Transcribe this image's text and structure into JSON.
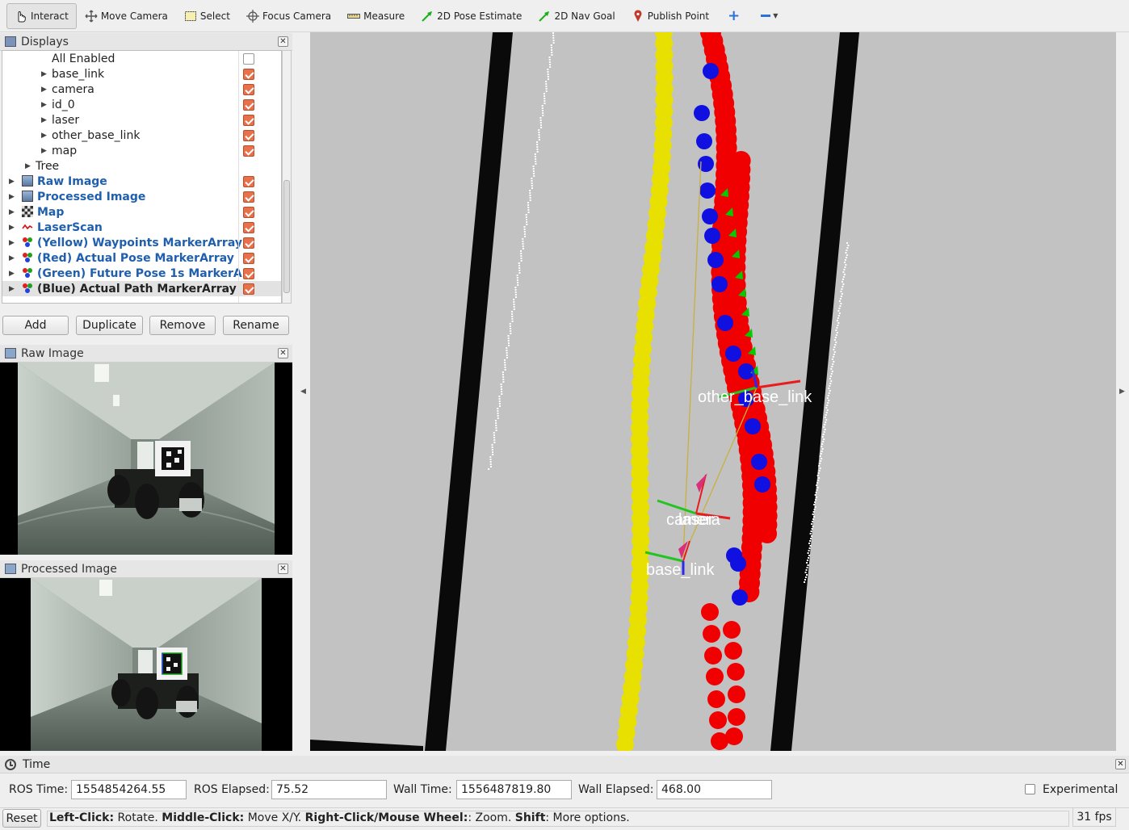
{
  "toolbar": {
    "tools": [
      {
        "label": "Interact",
        "icon": "hand-pointer-icon"
      },
      {
        "label": "Move Camera",
        "icon": "move-camera-icon"
      },
      {
        "label": "Select",
        "icon": "select-box-icon"
      },
      {
        "label": "Focus Camera",
        "icon": "crosshair-icon"
      },
      {
        "label": "Measure",
        "icon": "ruler-icon"
      },
      {
        "label": "2D Pose Estimate",
        "icon": "green-arrow-icon"
      },
      {
        "label": "2D Nav Goal",
        "icon": "green-arrow-icon"
      },
      {
        "label": "Publish Point",
        "icon": "map-pin-icon"
      }
    ]
  },
  "displays": {
    "title": "Displays",
    "items": [
      {
        "label": "All Enabled",
        "checked": false
      },
      {
        "label": "base_link",
        "checked": true
      },
      {
        "label": "camera",
        "checked": true
      },
      {
        "label": "id_0",
        "checked": true
      },
      {
        "label": "laser",
        "checked": true
      },
      {
        "label": "other_base_link",
        "checked": true
      },
      {
        "label": "map",
        "checked": true
      },
      {
        "label": "Tree"
      },
      {
        "label": "Raw Image",
        "checked": true
      },
      {
        "label": "Processed Image",
        "checked": true
      },
      {
        "label": "Map",
        "checked": true
      },
      {
        "label": "LaserScan",
        "checked": true
      },
      {
        "label": "(Yellow) Waypoints MarkerArray",
        "checked": true
      },
      {
        "label": "(Red) Actual Pose MarkerArray",
        "checked": true
      },
      {
        "label": "(Green) Future Pose 1s MarkerA...",
        "checked": true
      },
      {
        "label": "(Blue) Actual Path MarkerArray",
        "checked": true
      }
    ],
    "buttons": {
      "add": "Add",
      "duplicate": "Duplicate",
      "remove": "Remove",
      "rename": "Rename"
    }
  },
  "raw_image": {
    "title": "Raw Image"
  },
  "processed_image": {
    "title": "Processed Image"
  },
  "viewport": {
    "labels": {
      "other": "other_base_link",
      "camera": "camera",
      "laser": "laser",
      "base": "base_link"
    }
  },
  "time": {
    "title": "Time",
    "ros_time_label": "ROS Time:",
    "ros_time": "1554854264.55",
    "ros_elapsed_label": "ROS Elapsed:",
    "ros_elapsed": "75.52",
    "wall_time_label": "Wall Time:",
    "wall_time": "1556487819.80",
    "wall_elapsed_label": "Wall Elapsed:",
    "wall_elapsed": "468.00",
    "experimental": "Experimental"
  },
  "status": {
    "reset": "Reset",
    "hint_parts": [
      {
        "b": "Left-Click:",
        "t": " Rotate. "
      },
      {
        "b": "Middle-Click:",
        "t": " Move X/Y. "
      },
      {
        "b": "Right-Click/Mouse Wheel:",
        "t": ": Zoom. "
      },
      {
        "b": "Shift",
        "t": ": More options."
      }
    ],
    "fps": "31 fps"
  },
  "colors": {
    "waypoints": "#e8e000",
    "actual_pose": "#f00000",
    "future_pose": "#00cc00",
    "actual_path": "#1010e0",
    "checkbox": "#e8704a",
    "blue_label": "#1f5fae"
  }
}
